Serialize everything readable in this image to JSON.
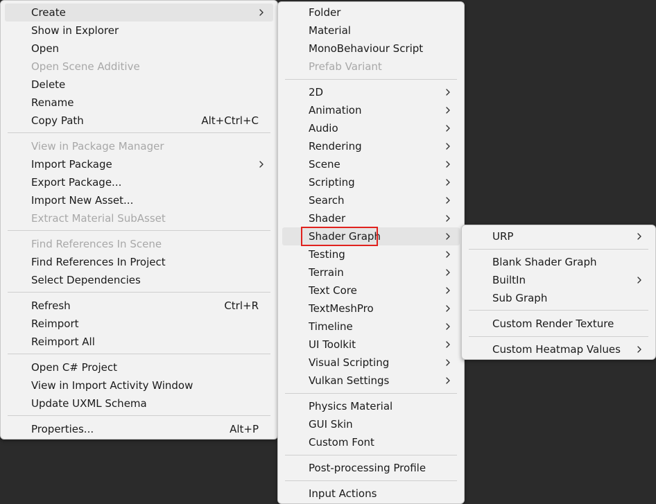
{
  "main_menu": {
    "items": [
      {
        "label": "Create",
        "submenu": true,
        "highlighted": true
      },
      {
        "label": "Show in Explorer"
      },
      {
        "label": "Open"
      },
      {
        "label": "Open Scene Additive",
        "disabled": true
      },
      {
        "label": "Delete"
      },
      {
        "label": "Rename"
      },
      {
        "label": "Copy Path",
        "shortcut": "Alt+Ctrl+C"
      },
      {
        "label": "View in Package Manager",
        "disabled": true
      },
      {
        "label": "Import Package",
        "submenu": true
      },
      {
        "label": "Export Package..."
      },
      {
        "label": "Import New Asset..."
      },
      {
        "label": "Extract Material SubAsset",
        "disabled": true
      },
      {
        "label": "Find References In Scene",
        "disabled": true
      },
      {
        "label": "Find References In Project"
      },
      {
        "label": "Select Dependencies"
      },
      {
        "label": "Refresh",
        "shortcut": "Ctrl+R"
      },
      {
        "label": "Reimport"
      },
      {
        "label": "Reimport All"
      },
      {
        "label": "Open C# Project"
      },
      {
        "label": "View in Import Activity Window"
      },
      {
        "label": "Update UXML Schema"
      },
      {
        "label": "Properties...",
        "shortcut": "Alt+P"
      }
    ]
  },
  "create_menu": {
    "items": [
      {
        "label": "Folder"
      },
      {
        "label": "Material"
      },
      {
        "label": "MonoBehaviour Script"
      },
      {
        "label": "Prefab Variant",
        "disabled": true
      },
      {
        "label": "2D",
        "submenu": true
      },
      {
        "label": "Animation",
        "submenu": true
      },
      {
        "label": "Audio",
        "submenu": true
      },
      {
        "label": "Rendering",
        "submenu": true
      },
      {
        "label": "Scene",
        "submenu": true
      },
      {
        "label": "Scripting",
        "submenu": true
      },
      {
        "label": "Search",
        "submenu": true
      },
      {
        "label": "Shader",
        "submenu": true
      },
      {
        "label": "Shader Graph",
        "submenu": true,
        "highlighted": true,
        "callout": true
      },
      {
        "label": "Testing",
        "submenu": true
      },
      {
        "label": "Terrain",
        "submenu": true
      },
      {
        "label": "Text Core",
        "submenu": true
      },
      {
        "label": "TextMeshPro",
        "submenu": true
      },
      {
        "label": "Timeline",
        "submenu": true
      },
      {
        "label": "UI Toolkit",
        "submenu": true
      },
      {
        "label": "Visual Scripting",
        "submenu": true
      },
      {
        "label": "Vulkan Settings",
        "submenu": true
      },
      {
        "label": "Physics Material"
      },
      {
        "label": "GUI Skin"
      },
      {
        "label": "Custom Font"
      },
      {
        "label": "Post-processing Profile"
      },
      {
        "label": "Input Actions"
      }
    ]
  },
  "shader_graph_menu": {
    "items": [
      {
        "label": "URP",
        "submenu": true
      },
      {
        "label": "Blank Shader Graph"
      },
      {
        "label": "BuiltIn",
        "submenu": true
      },
      {
        "label": "Sub Graph"
      },
      {
        "label": "Custom Render Texture"
      },
      {
        "label": "Custom Heatmap Values",
        "submenu": true
      }
    ]
  },
  "colors": {
    "menu_background": "#f2f2f2",
    "highlight_background": "#e4e4e4",
    "disabled_text": "#a8a8a8",
    "callout_border": "#e0211d",
    "desktop_background": "#2b2b2b"
  }
}
